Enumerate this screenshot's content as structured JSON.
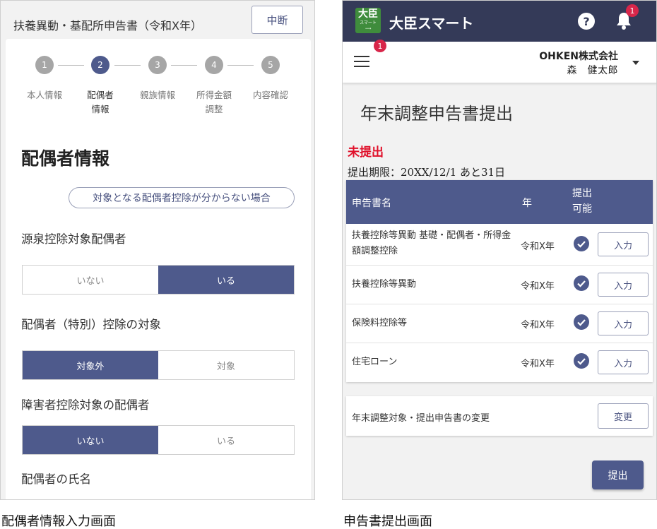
{
  "left": {
    "title": "扶養異動・基配所申告書（令和X年）",
    "suspend_label": "中断",
    "steps": [
      {
        "num": "1",
        "label": "本人情報"
      },
      {
        "num": "2",
        "label": "配偶者\n情報"
      },
      {
        "num": "3",
        "label": "親族情報"
      },
      {
        "num": "4",
        "label": "所得金額\n調整"
      },
      {
        "num": "5",
        "label": "内容確認"
      }
    ],
    "heading": "配偶者情報",
    "help_link": "対象となる配偶者控除が分からない場合",
    "questions": [
      {
        "label": "源泉控除対象配偶者",
        "options": [
          "いない",
          "いる"
        ],
        "selected": "いる"
      },
      {
        "label": "配偶者（特別）控除の対象",
        "options": [
          "対象外",
          "対象"
        ],
        "selected": "対象外"
      },
      {
        "label": "障害者控除対象の配偶者",
        "options": [
          "いない",
          "いる"
        ],
        "selected": "いない"
      }
    ],
    "name_label": "配偶者の氏名",
    "caption": "配偶者情報入力画面"
  },
  "right": {
    "logo": {
      "line1": "大臣",
      "line2": "スマート",
      "line3": "⟿"
    },
    "app_name": "大臣スマート",
    "help_icon": "?",
    "bell_badge": "1",
    "menu_badge": "1",
    "company": "OHKEN株式会社",
    "user": "森　健太郎",
    "page_title": "年末調整申告書提出",
    "status": "未提出",
    "deadline": "提出期限：20XX/12/1 あと31日",
    "table": {
      "headers": {
        "name": "申告書名",
        "year": "年",
        "submit": "提出\n可能"
      },
      "rows": [
        {
          "name": "扶養控除等異動 基礎・配偶者・所得金額調整控除",
          "year": "令和X年",
          "button": "入力"
        },
        {
          "name": "扶養控除等異動",
          "year": "令和X年",
          "button": "入力"
        },
        {
          "name": "保険料控除等",
          "year": "令和X年",
          "button": "入力"
        },
        {
          "name": "住宅ローン",
          "year": "令和X年",
          "button": "入力"
        }
      ]
    },
    "change_label": "年末調整対象・提出申告書の変更",
    "change_button": "変更",
    "submit_button": "提出",
    "caption": "申告書提出画面"
  },
  "colors": {
    "primary": "#4e5a8c",
    "appbar": "#343a58",
    "alert": "#e0102a",
    "badge": "#d8264a",
    "logo": "#3f8c3c"
  }
}
